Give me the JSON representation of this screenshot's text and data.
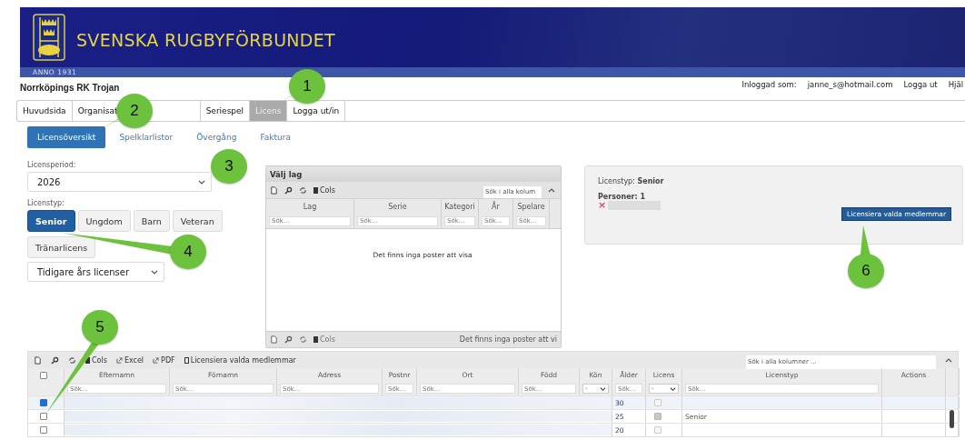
{
  "header": {
    "title": "SVENSKA RUGBYFÖRBUNDET",
    "since": "ANNO 1931"
  },
  "club": "Norrköpings RK Trojan",
  "user": {
    "label": "Inloggad som:",
    "email": "janne_s@hotmail.com",
    "logout": "Logga ut",
    "help": "Hjäl"
  },
  "nav": [
    {
      "label": "Huvudsida",
      "selected": false
    },
    {
      "label": "Organisat",
      "selected": false
    },
    {
      "label": "Seriespel",
      "selected": false
    },
    {
      "label": "Licens",
      "selected": true
    },
    {
      "label": "Logga ut/in",
      "selected": false
    }
  ],
  "subtabs": [
    {
      "label": "Licensöversikt",
      "selected": true
    },
    {
      "label": "Spelklarlistor",
      "selected": false
    },
    {
      "label": "Övergång",
      "selected": false
    },
    {
      "label": "Faktura",
      "selected": false
    }
  ],
  "filters": {
    "period_label": "Licensperiod:",
    "period": "2026",
    "type_label": "Licenstyp:",
    "types": [
      {
        "label": "Senior",
        "selected": true
      },
      {
        "label": "Ungdom",
        "selected": false
      },
      {
        "label": "Barn",
        "selected": false
      },
      {
        "label": "Veteran",
        "selected": false
      },
      {
        "label": "Tränarlicens",
        "selected": false
      }
    ],
    "previous": "Tidigare års licenser"
  },
  "team_panel": {
    "title": "Välj lag",
    "cols": "Cols",
    "search_placeholder": "Sök i alla kolum",
    "columns": [
      {
        "label": "Lag",
        "placeholder": "Sök..."
      },
      {
        "label": "Serie",
        "placeholder": "Sök..."
      },
      {
        "label": "Kategori",
        "placeholder": "Sök..."
      },
      {
        "label": "År",
        "placeholder": "Sök..."
      },
      {
        "label": "Spelare",
        "placeholder": "Sök..."
      }
    ],
    "empty": "Det finns inga poster att visa",
    "footer_cols": "Cols",
    "footer_status": "Det finns inga poster att vi"
  },
  "summary": {
    "type_label": "Licenstyp:",
    "type": "Senior",
    "persons": "Personer: 1",
    "remove": "×",
    "button": "Licensiera valda medlemmar"
  },
  "grid": {
    "toolbar": {
      "cols": "Cols",
      "excel": "Excel",
      "pdf": "PDF",
      "license": "Licensiera valda medlemmar"
    },
    "search_placeholder": "Sök i alla kolumner ...",
    "select_all_checked": false,
    "columns": [
      {
        "label": "Efternamn",
        "placeholder": "Sök..."
      },
      {
        "label": "Förnamn",
        "placeholder": "Sök..."
      },
      {
        "label": "Adress",
        "placeholder": "Sök..."
      },
      {
        "label": "Postnr",
        "placeholder": "Sök..."
      },
      {
        "label": "Ort",
        "placeholder": "Sök..."
      },
      {
        "label": "Född",
        "placeholder": "Sök..."
      },
      {
        "label": "Kön",
        "kind": "select",
        "value": "-"
      },
      {
        "label": "Ålder",
        "placeholder": "Sök..."
      },
      {
        "label": "Licens",
        "kind": "select",
        "value": "-"
      },
      {
        "label": "Licenstyp",
        "placeholder": "Sök..."
      },
      {
        "label": "Actions"
      }
    ],
    "rows": [
      {
        "selected": true,
        "age": "30",
        "licensed": false
      },
      {
        "selected": false,
        "age": "25",
        "licensed": true,
        "type": "Senior"
      },
      {
        "selected": false,
        "age": "20",
        "licensed": false
      }
    ]
  },
  "callouts": [
    "1",
    "2",
    "3",
    "4",
    "5",
    "6"
  ]
}
